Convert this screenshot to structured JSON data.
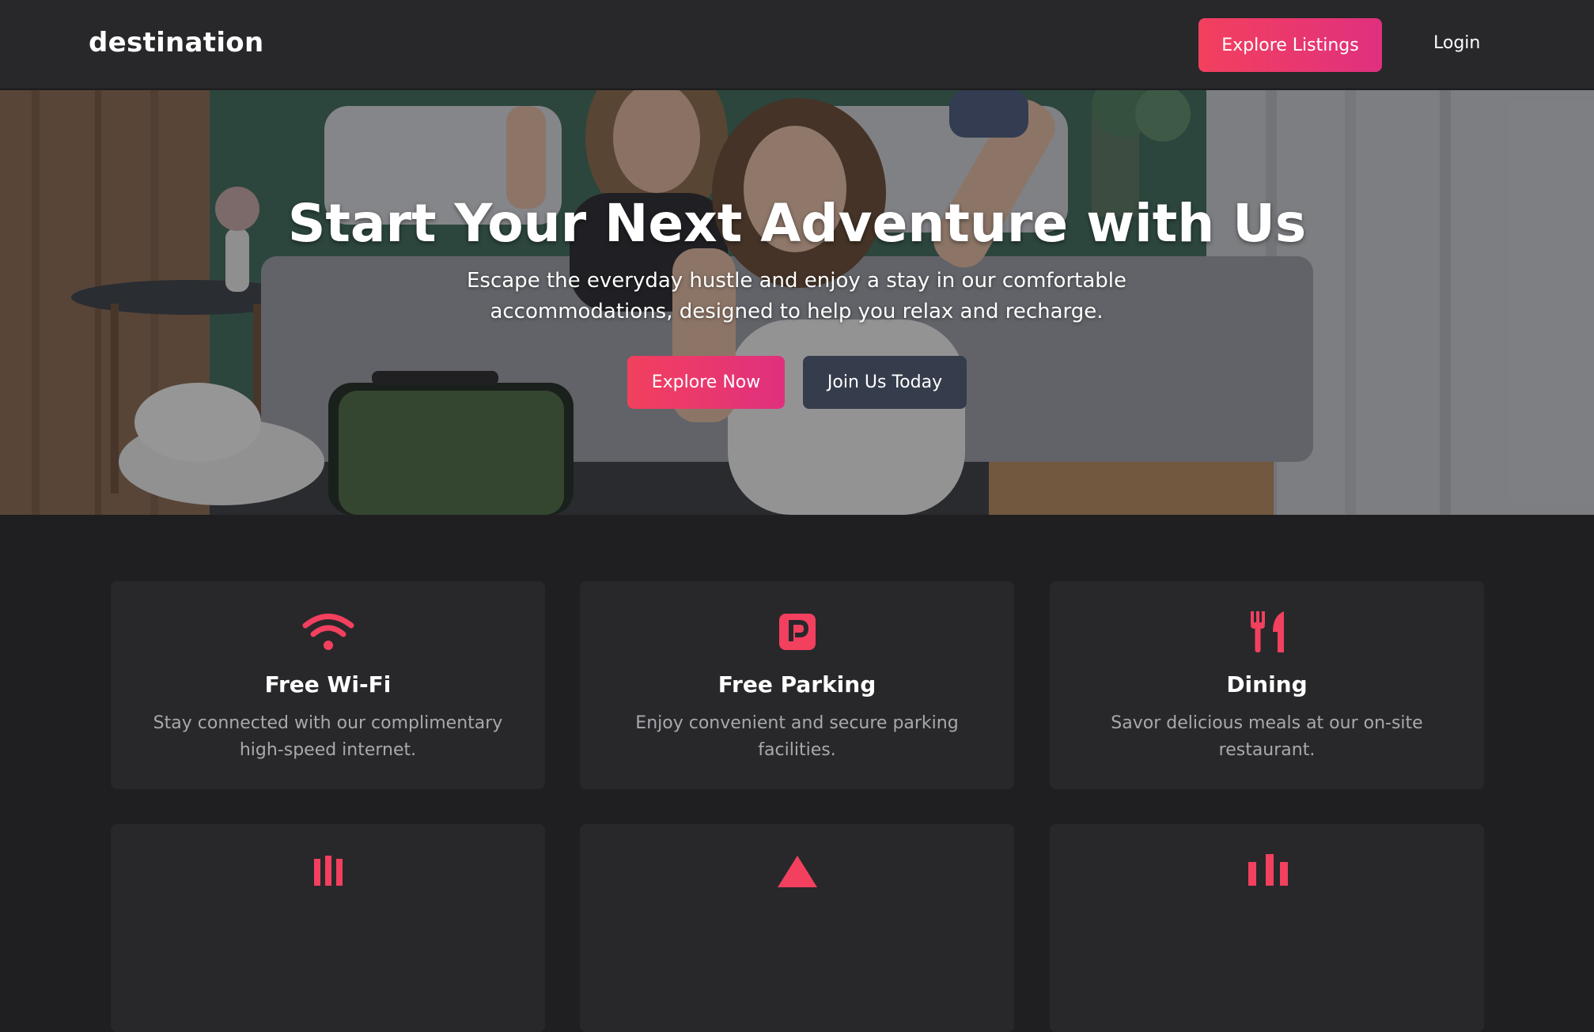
{
  "nav": {
    "brand": "destination",
    "explore_listings": "Explore Listings",
    "login": "Login"
  },
  "hero": {
    "title": "Start Your Next Adventure with Us",
    "subtitle": "Escape the everyday hustle and enjoy a stay in our comfortable accommodations, designed to help you relax and recharge.",
    "explore_now": "Explore Now",
    "join_us": "Join Us Today"
  },
  "features": [
    {
      "icon": "wifi-icon",
      "title": "Free Wi-Fi",
      "description": "Stay connected with our complimentary high-speed internet."
    },
    {
      "icon": "parking-icon",
      "title": "Free Parking",
      "description": "Enjoy convenient and secure parking facilities."
    },
    {
      "icon": "utensils-icon",
      "title": "Dining",
      "description": "Savor delicious meals at our on-site restaurant."
    }
  ],
  "colors": {
    "accent": "#f2405e",
    "accent_end": "#e0307e",
    "secondary_button": "#353c4c",
    "card_background": "#28282b",
    "page_background": "#1f1f21"
  }
}
